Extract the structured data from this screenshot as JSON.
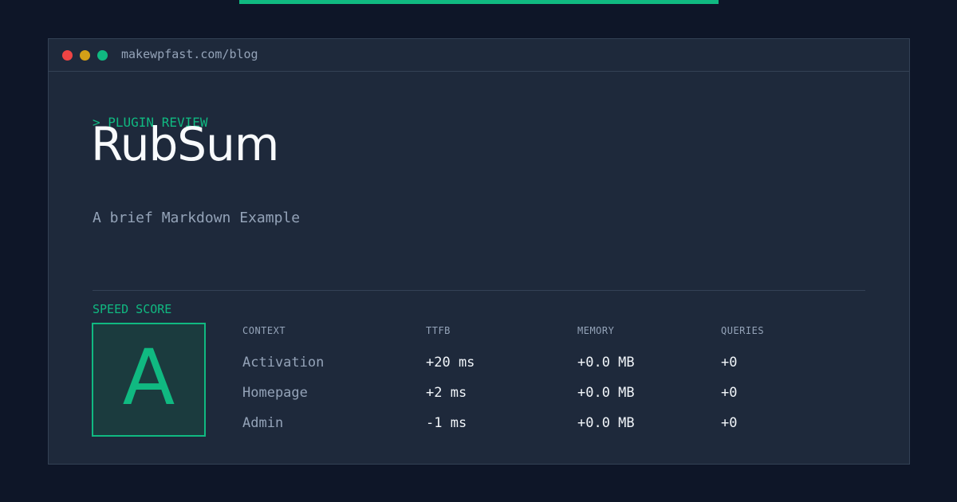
{
  "browser": {
    "url": "makewpfast.com/blog"
  },
  "post": {
    "eyebrow": "> PLUGIN REVIEW",
    "title": "RubSum",
    "subtitle": "A brief Markdown Example"
  },
  "score": {
    "label": "SPEED SCORE",
    "grade": "A"
  },
  "table": {
    "headers": [
      "CONTEXT",
      "TTFB",
      "MEMORY",
      "QUERIES"
    ],
    "rows": [
      [
        "Activation",
        "+20 ms",
        "+0.0 MB",
        "+0"
      ],
      [
        "Homepage",
        "+2 ms",
        "+0.0 MB",
        "+0"
      ],
      [
        "Admin",
        "-1 ms",
        "+0.0 MB",
        "+0"
      ]
    ]
  },
  "colors": {
    "accent": "#10b981",
    "background": "#0e1628",
    "panel": "#1e293b",
    "muted_text": "#94a3b8",
    "window_dot_red": "#ef4444",
    "window_dot_yellow": "#d4a017",
    "window_dot_green": "#10b981"
  }
}
